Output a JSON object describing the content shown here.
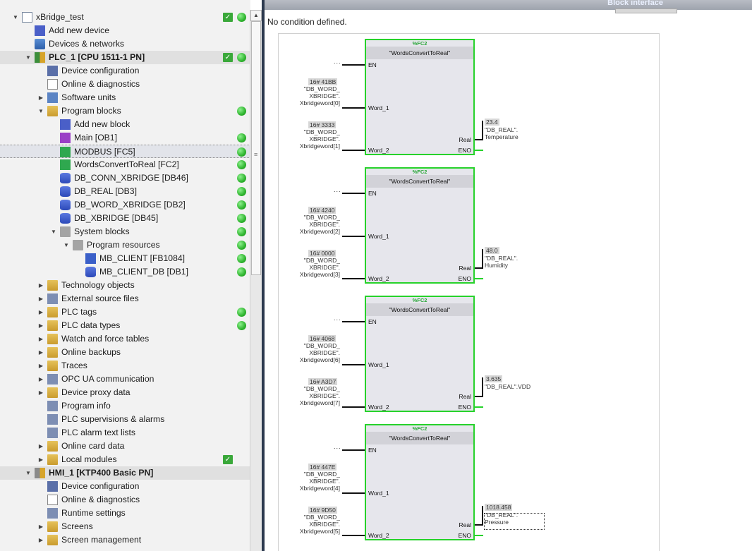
{
  "tree": {
    "items": [
      {
        "label": "xBridge_test",
        "exp": "▼",
        "icon": "project-icon",
        "cls": "i-proj",
        "indent": 0,
        "check": true,
        "dot": true
      },
      {
        "label": "Add new device",
        "exp": "",
        "icon": "add-device-icon",
        "cls": "i-add",
        "indent": 1,
        "check": false,
        "dot": false
      },
      {
        "label": "Devices & networks",
        "exp": "",
        "icon": "network-icon",
        "cls": "i-net",
        "indent": 1,
        "check": false,
        "dot": false
      },
      {
        "label": "PLC_1 [CPU 1511-1 PN]",
        "exp": "▼",
        "icon": "plc-icon",
        "cls": "i-plc",
        "indent": 1,
        "check": true,
        "dot": true,
        "bold": true,
        "dev": true
      },
      {
        "label": "Device configuration",
        "exp": "",
        "icon": "device-config-icon",
        "cls": "i-devcfg",
        "indent": 2,
        "check": false,
        "dot": false
      },
      {
        "label": "Online & diagnostics",
        "exp": "",
        "icon": "diagnostics-icon",
        "cls": "i-diag",
        "indent": 2,
        "check": false,
        "dot": false
      },
      {
        "label": "Software units",
        "exp": "▶",
        "icon": "software-units-icon",
        "cls": "i-units",
        "indent": 2,
        "check": false,
        "dot": false
      },
      {
        "label": "Program blocks",
        "exp": "▼",
        "icon": "folder-icon",
        "cls": "i-folder",
        "indent": 2,
        "check": false,
        "dot": true
      },
      {
        "label": "Add new block",
        "exp": "",
        "icon": "add-block-icon",
        "cls": "i-add",
        "indent": 3,
        "check": false,
        "dot": false
      },
      {
        "label": "Main [OB1]",
        "exp": "",
        "icon": "ob-icon",
        "cls": "i-ob",
        "indent": 3,
        "check": false,
        "dot": true
      },
      {
        "label": "MODBUS [FC5]",
        "exp": "",
        "icon": "fc-icon",
        "cls": "i-fc",
        "indent": 3,
        "check": false,
        "dot": true,
        "sel": true
      },
      {
        "label": "WordsConvertToReal [FC2]",
        "exp": "",
        "icon": "fc-icon",
        "cls": "i-fc",
        "indent": 3,
        "check": false,
        "dot": true
      },
      {
        "label": "DB_CONN_XBRIDGE [DB46]",
        "exp": "",
        "icon": "db-icon",
        "cls": "i-db",
        "indent": 3,
        "check": false,
        "dot": true
      },
      {
        "label": "DB_REAL [DB3]",
        "exp": "",
        "icon": "db-icon",
        "cls": "i-db",
        "indent": 3,
        "check": false,
        "dot": true
      },
      {
        "label": "DB_WORD_XBRIDGE [DB2]",
        "exp": "",
        "icon": "db-icon",
        "cls": "i-db",
        "indent": 3,
        "check": false,
        "dot": true
      },
      {
        "label": "DB_XBRIDGE [DB45]",
        "exp": "",
        "icon": "db-icon",
        "cls": "i-db",
        "indent": 3,
        "check": false,
        "dot": true
      },
      {
        "label": "System blocks",
        "exp": "▼",
        "icon": "system-blocks-icon",
        "cls": "i-sys",
        "indent": 3,
        "check": false,
        "dot": true
      },
      {
        "label": "Program resources",
        "exp": "▼",
        "icon": "program-resources-icon",
        "cls": "i-sys",
        "indent": 4,
        "check": false,
        "dot": true
      },
      {
        "label": "MB_CLIENT [FB1084]",
        "exp": "",
        "icon": "fb-icon",
        "cls": "i-fb",
        "indent": 5,
        "check": false,
        "dot": true
      },
      {
        "label": "MB_CLIENT_DB [DB1]",
        "exp": "",
        "icon": "db-icon",
        "cls": "i-db",
        "indent": 5,
        "check": false,
        "dot": true
      },
      {
        "label": "Technology objects",
        "exp": "▶",
        "icon": "folder-icon",
        "cls": "i-folder",
        "indent": 2,
        "check": false,
        "dot": false
      },
      {
        "label": "External source files",
        "exp": "▶",
        "icon": "source-files-icon",
        "cls": "i-gen",
        "indent": 2,
        "check": false,
        "dot": false
      },
      {
        "label": "PLC tags",
        "exp": "▶",
        "icon": "plc-tags-icon",
        "cls": "i-folder",
        "indent": 2,
        "check": false,
        "dot": true
      },
      {
        "label": "PLC data types",
        "exp": "▶",
        "icon": "data-types-icon",
        "cls": "i-folder",
        "indent": 2,
        "check": false,
        "dot": true
      },
      {
        "label": "Watch and force tables",
        "exp": "▶",
        "icon": "watch-tables-icon",
        "cls": "i-folder",
        "indent": 2,
        "check": false,
        "dot": false
      },
      {
        "label": "Online backups",
        "exp": "▶",
        "icon": "backups-icon",
        "cls": "i-folder",
        "indent": 2,
        "check": false,
        "dot": false
      },
      {
        "label": "Traces",
        "exp": "▶",
        "icon": "traces-icon",
        "cls": "i-folder",
        "indent": 2,
        "check": false,
        "dot": false
      },
      {
        "label": "OPC UA communication",
        "exp": "▶",
        "icon": "opc-ua-icon",
        "cls": "i-gen",
        "indent": 2,
        "check": false,
        "dot": false
      },
      {
        "label": "Device proxy data",
        "exp": "▶",
        "icon": "proxy-data-icon",
        "cls": "i-folder",
        "indent": 2,
        "check": false,
        "dot": false
      },
      {
        "label": "Program info",
        "exp": "",
        "icon": "program-info-icon",
        "cls": "i-gen",
        "indent": 2,
        "check": false,
        "dot": false
      },
      {
        "label": "PLC supervisions & alarms",
        "exp": "",
        "icon": "alarms-icon",
        "cls": "i-gen",
        "indent": 2,
        "check": false,
        "dot": false
      },
      {
        "label": "PLC alarm text lists",
        "exp": "",
        "icon": "text-lists-icon",
        "cls": "i-gen",
        "indent": 2,
        "check": false,
        "dot": false
      },
      {
        "label": "Online card data",
        "exp": "▶",
        "icon": "card-data-icon",
        "cls": "i-folder",
        "indent": 2,
        "check": false,
        "dot": false
      },
      {
        "label": "Local modules",
        "exp": "▶",
        "icon": "local-modules-icon",
        "cls": "i-folder",
        "indent": 2,
        "check": true,
        "dot": false
      },
      {
        "label": "HMI_1 [KTP400 Basic PN]",
        "exp": "▼",
        "icon": "hmi-icon",
        "cls": "i-hmi",
        "indent": 1,
        "check": false,
        "dot": false,
        "bold": true,
        "dev": true
      },
      {
        "label": "Device configuration",
        "exp": "",
        "icon": "device-config-icon",
        "cls": "i-devcfg",
        "indent": 2,
        "check": false,
        "dot": false
      },
      {
        "label": "Online & diagnostics",
        "exp": "",
        "icon": "diagnostics-icon",
        "cls": "i-diag",
        "indent": 2,
        "check": false,
        "dot": false
      },
      {
        "label": "Runtime settings",
        "exp": "",
        "icon": "runtime-settings-icon",
        "cls": "i-gen",
        "indent": 2,
        "check": false,
        "dot": false
      },
      {
        "label": "Screens",
        "exp": "▶",
        "icon": "folder-icon",
        "cls": "i-folder",
        "indent": 2,
        "check": false,
        "dot": false
      },
      {
        "label": "Screen management",
        "exp": "▶",
        "icon": "folder-icon",
        "cls": "i-folder",
        "indent": 2,
        "check": false,
        "dot": false
      }
    ]
  },
  "editor": {
    "interface_title": "Block interface",
    "condition_text": "No condition defined.",
    "blocks": [
      {
        "number": "%FC2",
        "name": "\"WordsConvertToReal\"",
        "pin_en": "EN",
        "pin_word1": "Word_1",
        "pin_word2": "Word_2",
        "pin_real": "Real",
        "pin_eno": "ENO",
        "en_dots": "...",
        "in1_value": "16# 41BB",
        "in1_var": "\"DB_WORD_\nXBRIDGE\".\nXbridgeword[0]",
        "in2_value": "16# 3333",
        "in2_var": "\"DB_WORD_\nXBRIDGE\".\nXbridgeword[1]",
        "out_value": "23.4",
        "out_var": "\"DB_REAL\".\nTemperature"
      },
      {
        "number": "%FC2",
        "name": "\"WordsConvertToReal\"",
        "pin_en": "EN",
        "pin_word1": "Word_1",
        "pin_word2": "Word_2",
        "pin_real": "Real",
        "pin_eno": "ENO",
        "en_dots": "...",
        "in1_value": "16# 4240",
        "in1_var": "\"DB_WORD_\nXBRIDGE\".\nXbridgeword[2]",
        "in2_value": "16# 0000",
        "in2_var": "\"DB_WORD_\nXBRIDGE\".\nXbridgeword[3]",
        "out_value": "48.0",
        "out_var": "\"DB_REAL\".\nHumidity"
      },
      {
        "number": "%FC2",
        "name": "\"WordsConvertToReal\"",
        "pin_en": "EN",
        "pin_word1": "Word_1",
        "pin_word2": "Word_2",
        "pin_real": "Real",
        "pin_eno": "ENO",
        "en_dots": "...",
        "in1_value": "16# 4068",
        "in1_var": "\"DB_WORD_\nXBRIDGE\".\nXbridgeword[6]",
        "in2_value": "16# A3D7",
        "in2_var": "\"DB_WORD_\nXBRIDGE\".\nXbridgeword[7]",
        "out_value": "3.635",
        "out_var": "\"DB_REAL\".VDD"
      },
      {
        "number": "%FC2",
        "name": "\"WordsConvertToReal\"",
        "pin_en": "EN",
        "pin_word1": "Word_1",
        "pin_word2": "Word_2",
        "pin_real": "Real",
        "pin_eno": "ENO",
        "en_dots": "...",
        "in1_value": "16# 447E",
        "in1_var": "\"DB_WORD_\nXBRIDGE\".\nXbridgeword[4]",
        "in2_value": "16# 9D50",
        "in2_var": "\"DB_WORD_\nXBRIDGE\".\nXbridgeword[5]",
        "out_value": "1018.458",
        "out_var": "\"DB_REAL\".\nPressure"
      }
    ]
  },
  "colors": {
    "active_block_border": "#27d22b",
    "status_ok": "#2fb52f",
    "check_ok": "#3aa83a"
  }
}
